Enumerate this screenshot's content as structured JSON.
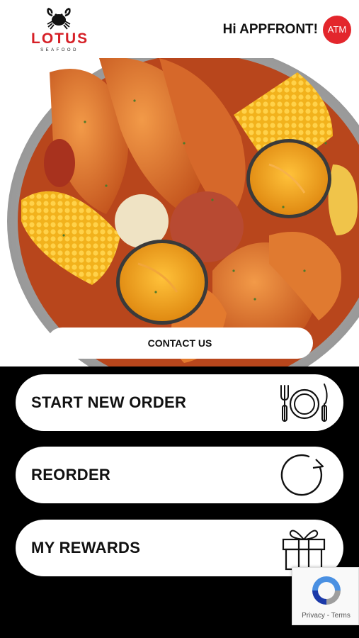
{
  "brand": {
    "name": "LOTUS",
    "tagline": "SEAFOOD"
  },
  "header": {
    "greeting": "Hi APPFRONT!",
    "avatar_initials": "ATM"
  },
  "hero": {
    "image": "seafood-boil-platter",
    "cta_label": "CONTACT US"
  },
  "menu": [
    {
      "label": "START NEW ORDER",
      "icon": "plate-cutlery-icon"
    },
    {
      "label": "REORDER",
      "icon": "refresh-icon"
    },
    {
      "label": "MY REWARDS",
      "icon": "gift-icon"
    }
  ],
  "recaptcha": {
    "links": "Privacy - Terms"
  },
  "colors": {
    "brand_red": "#d62027",
    "avatar_red": "#e3262c",
    "background": "#000000"
  }
}
